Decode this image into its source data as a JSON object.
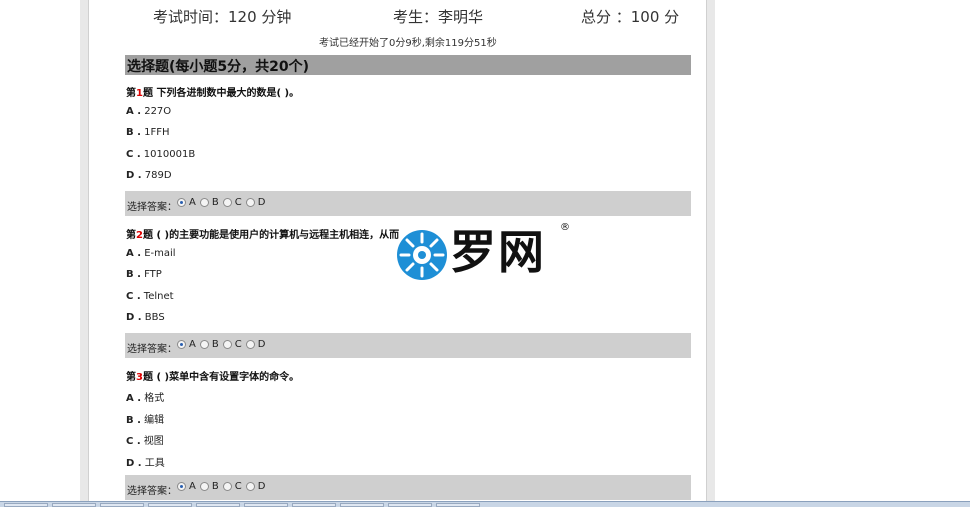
{
  "header": {
    "time_label": "考试时间：120 分钟",
    "student_label": "考生：李明华",
    "score_label": "总分 ：100 分",
    "timer_text": "考试已经开始了0分9秒,剩余119分51秒"
  },
  "section": {
    "title": "选择题(每小题5分，共20个)"
  },
  "answer_label": "选择答案：",
  "choice_letters": [
    "A",
    "B",
    "C",
    "D"
  ],
  "questions": [
    {
      "prefix": "第",
      "number": "1",
      "suffix": "题",
      "text": " 下列各进制数中最大的数是( )。",
      "options": [
        {
          "letter": "A .",
          "text": " 227O"
        },
        {
          "letter": "B .",
          "text": " 1FFH"
        },
        {
          "letter": "C .",
          "text": " 1010001B"
        },
        {
          "letter": "D .",
          "text": " 789D"
        }
      ],
      "selected": "A"
    },
    {
      "prefix": "第",
      "number": "2",
      "suffix": "题",
      "text": " ( )的主要功能是使用户的计算机与远程主机相连，从而",
      "options": [
        {
          "letter": "A .",
          "text": " E-mail"
        },
        {
          "letter": "B .",
          "text": " FTP"
        },
        {
          "letter": "C .",
          "text": " Telnet"
        },
        {
          "letter": "D .",
          "text": " BBS"
        }
      ],
      "selected": "A"
    },
    {
      "prefix": "第",
      "number": "3",
      "suffix": "题",
      "text": " ( )菜单中含有设置字体的命令。",
      "options": [
        {
          "letter": "A .",
          "text": " 格式"
        },
        {
          "letter": "B .",
          "text": " 编辑"
        },
        {
          "letter": "C .",
          "text": " 视图"
        },
        {
          "letter": "D .",
          "text": " 工具"
        }
      ],
      "selected": "A"
    }
  ],
  "watermark": {
    "text": "罗网",
    "registered": "®"
  },
  "colors": {
    "section_bar": "#a0a0a0",
    "answer_bar": "#cfcfcf",
    "question_number": "#dd0000",
    "logo_blue": "#1e8fd6"
  }
}
